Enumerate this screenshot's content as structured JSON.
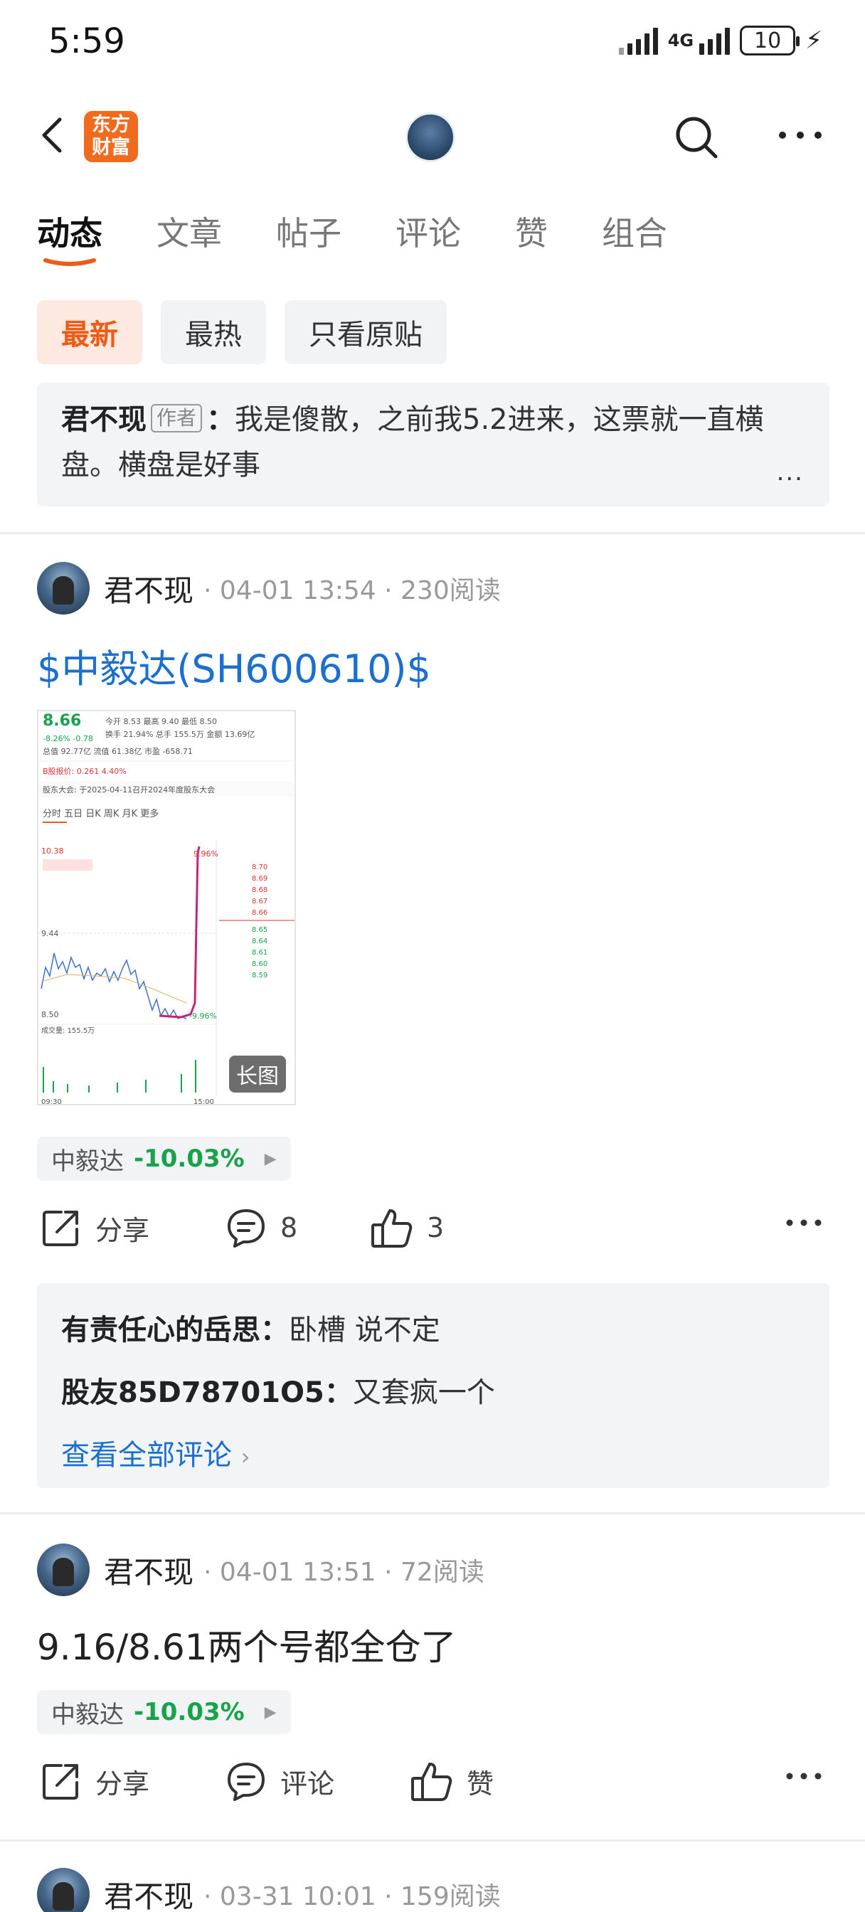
{
  "status_bar": {
    "time": "5:59",
    "network": "4G",
    "battery": "10"
  },
  "header": {
    "logo_line1": "东方",
    "logo_line2": "财富"
  },
  "tabs": [
    {
      "label": "动态"
    },
    {
      "label": "文章"
    },
    {
      "label": "帖子"
    },
    {
      "label": "评论"
    },
    {
      "label": "赞"
    },
    {
      "label": "组合"
    }
  ],
  "filters": [
    {
      "label": "最新"
    },
    {
      "label": "最热"
    },
    {
      "label": "只看原贴"
    }
  ],
  "pinned": {
    "author": "君不现",
    "tag": "作者",
    "sep": "：",
    "text": "我是傻散，之前我5.2进来，这票就一直横盘。横盘是好事",
    "ellipsis": "..."
  },
  "posts": [
    {
      "author": "君不现",
      "meta": "· 04-01 13:54 · 230阅读",
      "title": "$中毅达(SH600610)$",
      "image_badge": "长图",
      "stock": {
        "name": "中毅达",
        "change": "-10.03%"
      },
      "actions": {
        "share": "分享",
        "comment": "8",
        "like": "3"
      },
      "comments": [
        {
          "name": "有责任心的岳思",
          "sep": "：",
          "text": "卧槽 说不定"
        },
        {
          "name": "股友85D78701O5",
          "sep": "：",
          "text": "又套疯一个"
        }
      ],
      "view_all": "查看全部评论"
    },
    {
      "author": "君不现",
      "meta": "· 04-01 13:51 · 72阅读",
      "text": "9.16/8.61两个号都全仓了",
      "stock": {
        "name": "中毅达",
        "change": "-10.03%"
      },
      "actions": {
        "share": "分享",
        "comment": "评论",
        "like": "赞"
      }
    },
    {
      "author": "君不现",
      "meta": "· 03-31 10:01 · 159阅读"
    }
  ],
  "thumbnail": {
    "price": "8.66",
    "change": "-8.26%  -0.78",
    "row1": "今开 8.53  最高 9.40  最低 8.50",
    "row2": "换手 21.94%  总手 155.5万  金额 13.69亿",
    "row3": "总值 92.77亿  流值 61.38亿  市盈 -658.71",
    "row4": "B股报价: 0.261  4.40%",
    "notice": "股东大会: 于2025-04-11召开2024年度股东大会",
    "chart_tabs": "分时  五日  日K  周K  月K  更多",
    "top_label": "10.38",
    "mid_label": "9.44",
    "low_label": "8.50",
    "high_pct": "9.96%",
    "low_pct": "-9.96%",
    "vol_label": "成交量: 155.5万",
    "time_start": "09:30",
    "time_end": "15:00",
    "ask_prices": [
      "8.70",
      "8.69",
      "8.68",
      "8.67",
      "8.66"
    ],
    "bid_prices": [
      "8.65",
      "8.64",
      "8.61",
      "8.60",
      "8.59"
    ]
  },
  "colors": {
    "accent": "#f05a14",
    "link": "#1a6fd1",
    "down": "#16a34a"
  }
}
